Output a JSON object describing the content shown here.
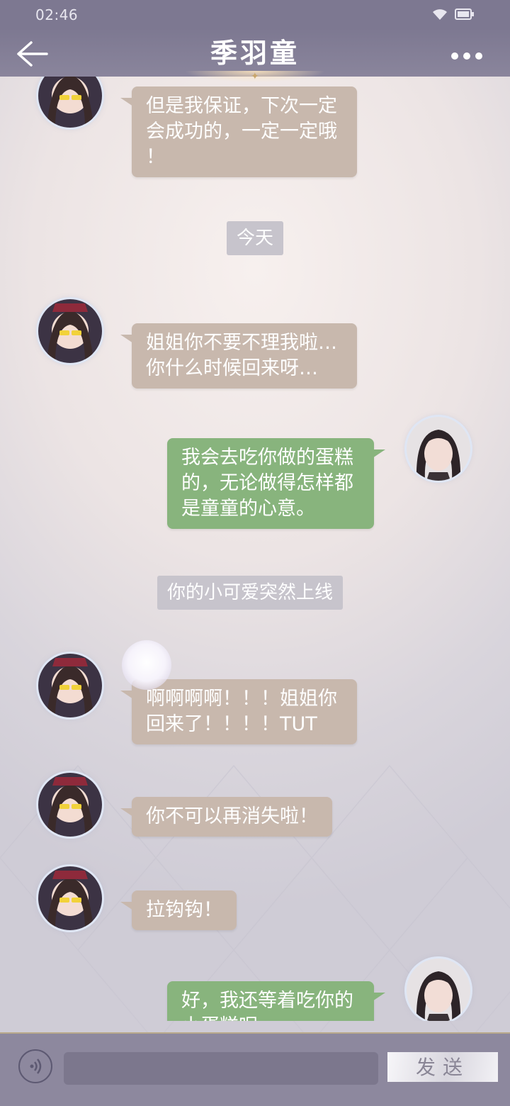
{
  "status_bar": {
    "time": "02:46"
  },
  "header": {
    "title": "季羽童",
    "back_icon": "arrow-left-icon",
    "more_icon": "more-dots-icon"
  },
  "messages": [
    {
      "side": "left",
      "lines": [
        "但是我保证，下次一定",
        "会成功的，一定一定哦",
        "！"
      ]
    },
    {
      "system": "今天"
    },
    {
      "side": "left",
      "lines": [
        "姐姐你不要不理我啦…",
        "你什么时候回来呀…"
      ]
    },
    {
      "side": "right",
      "lines": [
        "我会去吃你做的蛋糕",
        "的，无论做得怎样都",
        "是童童的心意。"
      ]
    },
    {
      "system": "你的小可爱突然上线"
    },
    {
      "side": "left",
      "lines": [
        "啊啊啊啊！！！姐姐你",
        "回来了！！！！TUT"
      ]
    },
    {
      "side": "left",
      "lines": [
        "你不可以再消失啦！"
      ]
    },
    {
      "side": "left",
      "lines": [
        "拉钩钩！"
      ]
    },
    {
      "side": "right",
      "lines": [
        "好，我还等着吃你的",
        "小蛋糕呢"
      ]
    }
  ],
  "input_bar": {
    "placeholder": "",
    "send_label": "发送",
    "voice_icon": "voice-icon"
  },
  "colors": {
    "left_bubble": "#c8b8ad",
    "right_bubble": "#88b47d",
    "header": "#7d7891",
    "system_msg": "#c7c4cc"
  }
}
